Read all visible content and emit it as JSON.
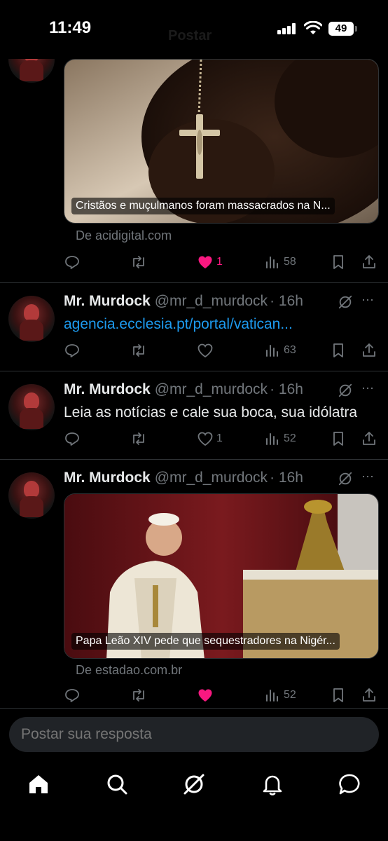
{
  "status_bar": {
    "time": "11:49",
    "battery": "49",
    "title_behind": "Postar"
  },
  "tweets": [
    {
      "card": {
        "caption": "Cristãos e muçulmanos foram massacrados na N...",
        "source": "De acidigital.com"
      },
      "actions": {
        "likes": "1",
        "views": "58"
      }
    },
    {
      "name": "Mr. Murdock",
      "handle": "@mr_d_murdock",
      "time": "· 16h",
      "text": "agencia.ecclesia.pt/portal/vatican...",
      "actions": {
        "views": "63"
      }
    },
    {
      "name": "Mr. Murdock",
      "handle": "@mr_d_murdock",
      "time": "· 16h",
      "text": "Leia as notícias e cale sua boca, sua idólatra",
      "actions": {
        "likes": "1",
        "views": "52"
      }
    },
    {
      "name": "Mr. Murdock",
      "handle": "@mr_d_murdock",
      "time": "· 16h",
      "card": {
        "caption": "Papa Leão XIV pede que sequestradores na Nigér...",
        "source": "De estadao.com.br"
      },
      "actions": {
        "views": "52"
      }
    }
  ],
  "reply": {
    "placeholder": "Postar sua resposta"
  },
  "colors": {
    "background": "#000000",
    "like": "#f91880",
    "link": "#1d9bf0",
    "muted": "#71767b",
    "text": "#e7e9ea"
  },
  "icons": {
    "more": "⋯"
  }
}
